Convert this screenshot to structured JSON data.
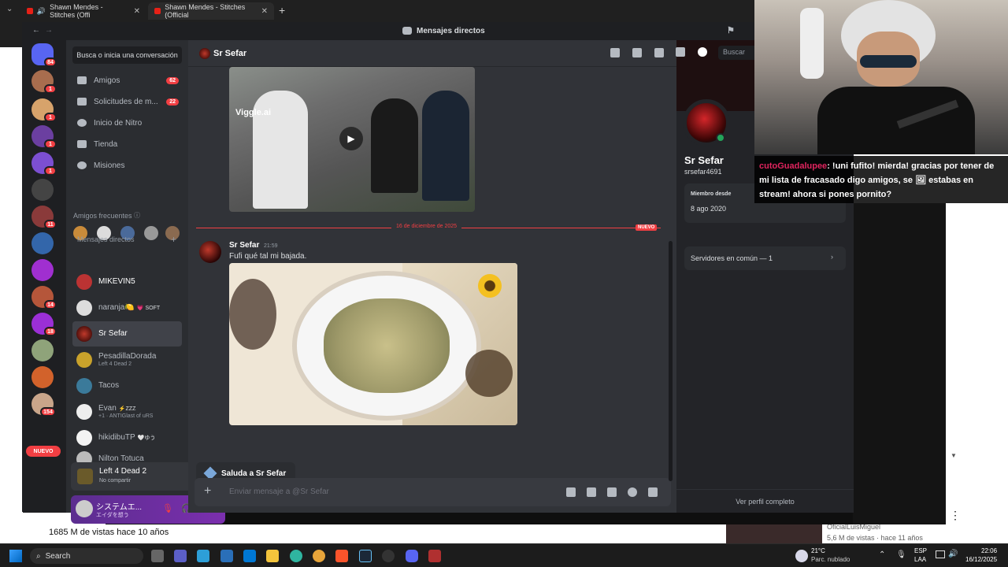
{
  "browser": {
    "tabs": [
      {
        "title": "Shawn Mendes - Stitches (Offi",
        "close": "✕"
      },
      {
        "title": "Shawn Mendes - Stitches (Official",
        "close": "✕"
      }
    ],
    "new_tab": "+"
  },
  "youtube": {
    "views": "1685 M de vistas  hace 10 años",
    "side_channel": "OficialLuisMiguel",
    "side_meta": "5,6 M de vistas · hace 11 años"
  },
  "discord": {
    "window_title": "Mensajes directos",
    "guild_badges": [
      "84",
      "1",
      "1",
      "1",
      "1",
      "11",
      "14",
      "18",
      "154"
    ],
    "nuevo_pill": "NUEVO",
    "search_conv": "Busca o inicia una conversación",
    "nav": [
      {
        "label": "Amigos",
        "badge": "62",
        "icon": "friends-icon"
      },
      {
        "label": "Solicitudes de m...",
        "badge": "22",
        "icon": "envelope-icon"
      },
      {
        "label": "Inicio de Nitro",
        "badge": "",
        "icon": "nitro-icon"
      },
      {
        "label": "Tienda",
        "badge": "",
        "icon": "shop-icon"
      },
      {
        "label": "Misiones",
        "badge": "",
        "icon": "quest-icon"
      }
    ],
    "frequent_friends_label": "Amigos frecuentes",
    "dm_header": "Mensajes directos",
    "dm_add": "+",
    "dms": [
      {
        "name": "MIKEVIN5",
        "sub": "",
        "tag": ""
      },
      {
        "name": "naranja🍋",
        "sub": "",
        "tag": "💗 SOFT"
      },
      {
        "name": "Sr Sefar",
        "sub": "",
        "tag": ""
      },
      {
        "name": "PesadillaDorada",
        "sub": "Left 4 Dead 2",
        "tag": ""
      },
      {
        "name": "Tacos",
        "sub": "",
        "tag": ""
      },
      {
        "name": "Evan",
        "sub": "+1 · ANTIGlast of uRS",
        "tag": "⚡ZZZ"
      },
      {
        "name": "hikidibuTP",
        "sub": "",
        "tag": "🤍ゆう"
      },
      {
        "name": "Nilton Totuca",
        "sub": "",
        "tag": ""
      }
    ],
    "game": {
      "title": "Left 4 Dead 2",
      "status": "No compartir"
    },
    "user": {
      "name": "システムエ...",
      "status": "エイダを想う"
    },
    "chat": {
      "header_name": "Sr Sefar",
      "search_placeholder": "Buscar",
      "video_watermark": "Viggle.ai",
      "date_divider": "16 de diciembre de 2025",
      "nuevo": "NUEVO",
      "message": {
        "author": "Sr Sefar",
        "time": "21:59",
        "text": "Fufi qué tal mi bajada."
      },
      "saluda": "Saluda a Sr Sefar",
      "composer_placeholder": "Enviar mensaje a @Sr Sefar"
    },
    "profile": {
      "name": "Sr Sefar",
      "username": "srsefar4691",
      "member_since_label": "Miembro desde",
      "member_since": "8 ago 2020",
      "servers_common": "Servidores en común — 1",
      "view_full": "Ver perfil completo"
    }
  },
  "stream_chat": {
    "user": "cutoGuadalupee",
    "message": ": !uni fufito! mierda! gracias por tener de mi lista de fracasado digo amigos, se 🖼 estabas en stream! ahora si pones pornito?"
  },
  "taskbar": {
    "search": "Search",
    "weather_temp": "21°C",
    "weather_desc": "Parc. nublado",
    "lang_top": "ESP",
    "lang_bottom": "LAA",
    "time": "22:06",
    "date": "16/12/2025"
  },
  "colors": {
    "discord_bg": "#313338",
    "discord_sidebar": "#2b2d31",
    "discord_dark": "#1e1f22",
    "accent_red": "#f23f43",
    "online_green": "#23a55a"
  }
}
